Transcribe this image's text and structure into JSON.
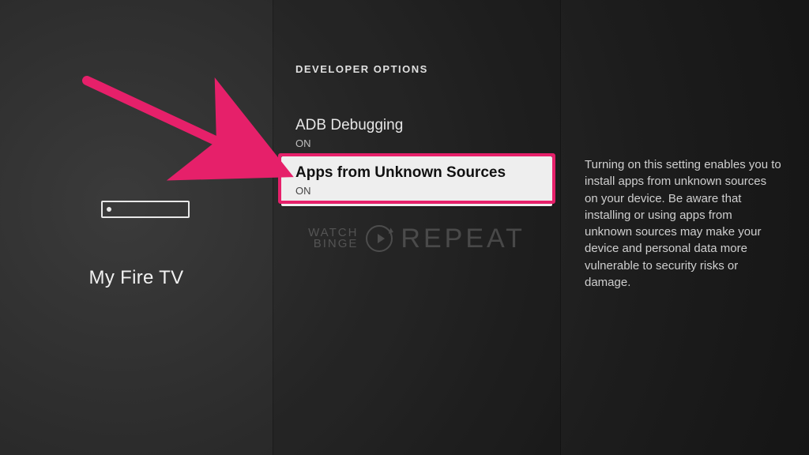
{
  "left": {
    "title": "My Fire TV"
  },
  "screen": {
    "title": "DEVELOPER OPTIONS"
  },
  "options": {
    "adb": {
      "label": "ADB Debugging",
      "state": "ON"
    },
    "unknown": {
      "label": "Apps from Unknown Sources",
      "state": "ON"
    }
  },
  "description": "Turning on this setting enables you to install apps from unknown sources on your device. Be aware that installing or using apps from unknown sources may make your device and personal data more vulnerable to security risks or damage.",
  "watermark": {
    "line1": "WATCH",
    "line2": "BINGE",
    "word": "REPEAT"
  },
  "colors": {
    "accent": "#e6206a"
  }
}
